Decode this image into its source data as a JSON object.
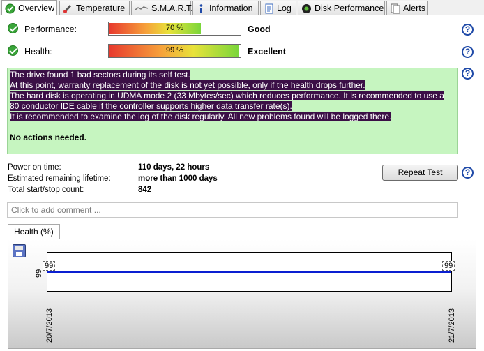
{
  "tabs": [
    {
      "label": "Overview",
      "icon": "check-circle-icon",
      "active": true
    },
    {
      "label": "Temperature",
      "icon": "thermometer-icon"
    },
    {
      "label": "S.M.A.R.T.",
      "icon": "smart-icon"
    },
    {
      "label": "Information",
      "icon": "info-icon"
    },
    {
      "label": "Log",
      "icon": "log-icon"
    },
    {
      "label": "Disk Performance",
      "icon": "disk-performance-icon"
    },
    {
      "label": "Alerts",
      "icon": "alerts-icon"
    }
  ],
  "performance": {
    "label": "Performance:",
    "value_text": "70 %",
    "value": 70,
    "status": "Good"
  },
  "health": {
    "label": "Health:",
    "value_text": "99 %",
    "value": 99,
    "status": "Excellent"
  },
  "message": {
    "lines": [
      "The drive found 1 bad sectors during its self test.",
      "At this point, warranty replacement of the disk is not yet possible, only if the health drops further.",
      "The hard disk is operating in UDMA mode 2 (33 Mbytes/sec) which reduces performance. It is recommended to use a 80 conductor IDE cable if the controller supports higher data transfer rate(s).",
      "It is recommended to examine the log of the disk regularly. All new problems found will be logged there."
    ],
    "conclusion": "No actions needed."
  },
  "info": {
    "power_on_label": "Power on time:",
    "power_on_value": "110 days, 22 hours",
    "lifetime_label": "Estimated remaining lifetime:",
    "lifetime_value": "more than 1000 days",
    "startstop_label": "Total start/stop count:",
    "startstop_value": "842"
  },
  "repeat_test_label": "Repeat Test",
  "comment_placeholder": "Click to add comment ...",
  "graph": {
    "tab_label": "Health (%)",
    "y_tick": "99",
    "start_value": "99",
    "end_value": "99",
    "x_start": "20/7/2013",
    "x_end": "21/7/2013"
  },
  "chart_data": {
    "type": "line",
    "x": [
      "20/7/2013",
      "21/7/2013"
    ],
    "series": [
      {
        "values": [
          99,
          99
        ]
      }
    ],
    "xlabel": "",
    "ylabel": "",
    "ylim": [
      99,
      99
    ]
  },
  "colors": {
    "line": "#0a1fd1",
    "message_bg": "#c6f5c0",
    "selection": "#3b0f46"
  }
}
